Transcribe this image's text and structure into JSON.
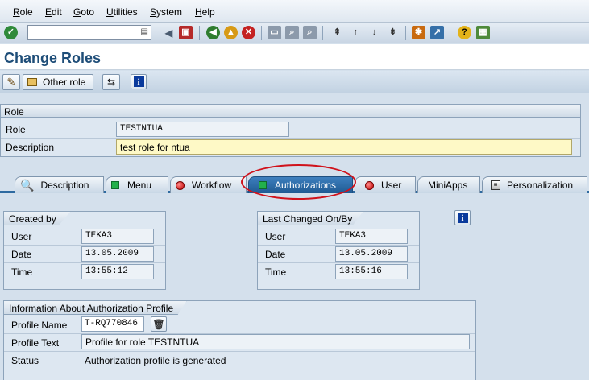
{
  "menu": [
    "Role",
    "Edit",
    "Goto",
    "Utilities",
    "System",
    "Help"
  ],
  "command_field": {
    "value": ""
  },
  "page_title": "Change Roles",
  "app_toolbar": {
    "other_role_label": "Other role"
  },
  "role_group": {
    "title": "Role",
    "role_label": "Role",
    "role_value": "TESTNTUA",
    "description_label": "Description",
    "description_value": "test role for ntua"
  },
  "tabs": [
    {
      "label": "Description",
      "icon": "magnifier-icon"
    },
    {
      "label": "Menu",
      "icon": "green-square-icon"
    },
    {
      "label": "Workflow",
      "icon": "red-circle-icon"
    },
    {
      "label": "Authorizations",
      "icon": "green-square-icon",
      "active": true
    },
    {
      "label": "User",
      "icon": "red-circle-icon"
    },
    {
      "label": "MiniApps",
      "icon": ""
    },
    {
      "label": "Personalization",
      "icon": "personalization-icon"
    }
  ],
  "created_by": {
    "title": "Created by",
    "user_label": "User",
    "user_value": "TEKA3",
    "date_label": "Date",
    "date_value": "13.05.2009",
    "time_label": "Time",
    "time_value": "13:55:12"
  },
  "last_changed": {
    "title": "Last Changed On/By",
    "user_label": "User",
    "user_value": "TEKA3",
    "date_label": "Date",
    "date_value": "13.05.2009",
    "time_label": "Time",
    "time_value": "13:55:16"
  },
  "auth_profile": {
    "title": "Information About Authorization Profile",
    "profile_name_label": "Profile Name",
    "profile_name_value": "T-RQ770846",
    "profile_text_label": "Profile Text",
    "profile_text_value": "Profile for role TESTNTUA",
    "status_label": "Status",
    "status_value": "Authorization profile is generated"
  },
  "colors": {
    "accent": "#1e4d78",
    "active_tab": "#2e6aa0",
    "highlight": "#d0121b"
  }
}
